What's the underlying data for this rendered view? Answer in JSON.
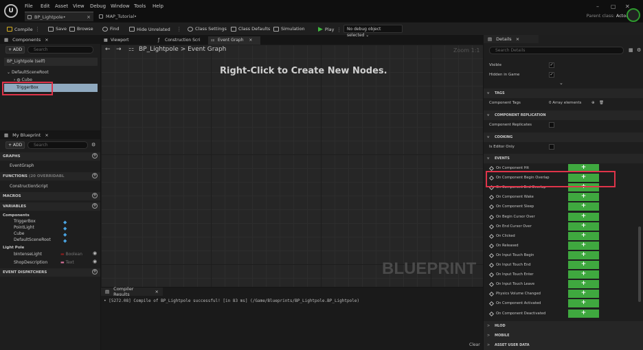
{
  "titlebar": {
    "logo": "U",
    "menu": [
      "File",
      "Edit",
      "Asset",
      "View",
      "Debug",
      "Window",
      "Tools",
      "Help"
    ],
    "tabs": [
      {
        "label": "BP_Lightpole•",
        "close": "×"
      },
      {
        "label": "MAP_Tutorial•"
      }
    ],
    "parent_class_label": "Parent class:",
    "parent_class_value": "Actor",
    "win_min": "–",
    "win_max": "▢",
    "win_close": "✕"
  },
  "toolbar": {
    "compile": "Compile",
    "save": "Save",
    "browse": "Browse",
    "find": "Find",
    "hide_unrelated": "Hide Unrelated",
    "class_settings": "Class Settings",
    "class_defaults": "Class Defaults",
    "simulation": "Simulation",
    "play": "Play",
    "debug_object": "No debug object selected",
    "dots": "⋮"
  },
  "components": {
    "title": "Components",
    "close": "×",
    "add": "+ ADD",
    "search_placeholder": "Search",
    "items": [
      "BP_Lightpole (self)",
      "DefaultSceneRoot",
      "Cube",
      "TriggerBox"
    ]
  },
  "myblueprint": {
    "title": "My Blueprint",
    "close": "×",
    "add": "+ ADD",
    "search_placeholder": "Search",
    "graphs": "GRAPHS",
    "event_graph": "EventGraph",
    "functions": "FUNCTIONS",
    "functions_sub": "(20 OVERRIDABL",
    "construction": "ConstructionScript",
    "macros": "MACROS",
    "variables": "VARIABLES",
    "components_cat": "Components",
    "var_components": [
      "TriggerBox",
      "PointLight",
      "Cube",
      "DefaultSceneRoot"
    ],
    "light_pole": "Light Pole",
    "vars": [
      {
        "name": "bIntenseLight",
        "type": "Boolean"
      },
      {
        "name": "ShopDescription",
        "type": "Text"
      }
    ],
    "dispatchers": "EVENT DISPATCHERS"
  },
  "editor": {
    "tabs": [
      "Viewport",
      "Construction Scri",
      "Event Graph"
    ],
    "close": "×",
    "breadcrumb_root": "BP_Lightpole",
    "breadcrumb_sep": ">",
    "breadcrumb_leaf": "Event Graph",
    "zoom": "Zoom 1:1",
    "hint": "Right-Click to Create New Nodes.",
    "watermark": "BLUEPRINT"
  },
  "compiler": {
    "title": "Compiler Results",
    "close": "×",
    "message": "• [5272.08] Compile of BP_Lightpole successful! [in 83 ms] (/Game/Blueprints/BP_Lightpole.BP_Lightpole)",
    "clear": "Clear"
  },
  "details": {
    "title": "Details",
    "close": "×",
    "search_placeholder": "Search Details",
    "visible": "Visible",
    "hidden_in_game": "Hidden in Game",
    "check": "✓",
    "tags": "TAGS",
    "component_tags": "Component Tags",
    "component_tags_value": "0 Array elements",
    "replication": "COMPONENT REPLICATION",
    "component_replicates": "Component Replicates",
    "cooking": "COOKING",
    "is_editor_only": "Is Editor Only",
    "events": "EVENTS",
    "plus": "+",
    "events_list": [
      "On Component Hit",
      "On Component Begin Overlap",
      "On Component End Overlap",
      "On Component Wake",
      "On Component Sleep",
      "On Begin Cursor Over",
      "On End Cursor Over",
      "On Clicked",
      "On Released",
      "On Input Touch Begin",
      "On Input Touch End",
      "On Input Touch Enter",
      "On Input Touch Leave",
      "Physics Volume Changed",
      "On Component Activated",
      "On Component Deactivated"
    ],
    "hlod": "HLOD",
    "mobile": "MOBILE",
    "asset_user_data": "ASSET USER DATA"
  },
  "colors": {
    "highlight": "#e0344a",
    "event_button": "#3fa83f",
    "selected_row": "#8fa9bf"
  }
}
